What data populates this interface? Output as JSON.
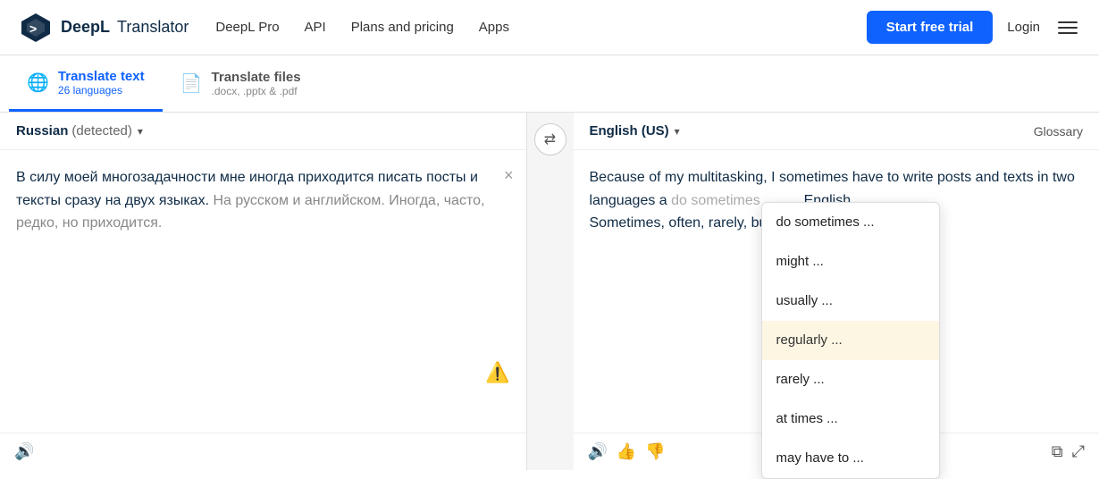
{
  "header": {
    "logo_bold": "DeepL",
    "logo_light": "Translator",
    "nav": [
      {
        "label": "DeepL Pro",
        "id": "deepl-pro"
      },
      {
        "label": "API",
        "id": "api"
      },
      {
        "label": "Plans and pricing",
        "id": "plans"
      },
      {
        "label": "Apps",
        "id": "apps"
      }
    ],
    "btn_trial": "Start free trial",
    "btn_login": "Login"
  },
  "tabs": [
    {
      "id": "translate-text",
      "icon": "🌐",
      "main": "Translate text",
      "sub": "26 languages",
      "active": true
    },
    {
      "id": "translate-files",
      "icon": "📄",
      "main": "Translate files",
      "sub": ".docx, .pptx & .pdf",
      "active": false
    }
  ],
  "source": {
    "lang_label": "Russian",
    "lang_detected": "(detected)",
    "text_dark": "В силу моей многозадачности мне иногда приходится писать посты и тексты сразу на двух языках.",
    "text_gray": "На русском и английском. Иногда, часто, редко, но приходится.",
    "close_label": "×"
  },
  "target": {
    "lang_label": "English (US)",
    "glossary": "Glossary",
    "text": "Because of my multitasking, I sometimes have to write posts and texts in two languages a",
    "text2": "English.",
    "text3": "Sometimes, often, rarely, but",
    "dropdown": [
      {
        "label": "do sometimes ...",
        "active": false
      },
      {
        "label": "might ...",
        "active": false
      },
      {
        "label": "usually ...",
        "active": false
      },
      {
        "label": "regularly ...",
        "active": true
      },
      {
        "label": "rarely ...",
        "active": false
      },
      {
        "label": "at times ...",
        "active": false
      },
      {
        "label": "may have to ...",
        "active": false
      }
    ]
  }
}
